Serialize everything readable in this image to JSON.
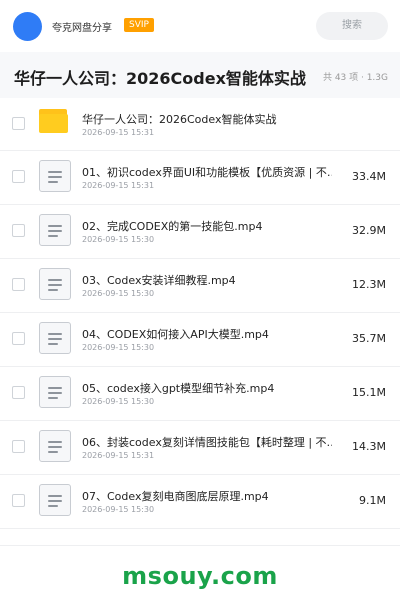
{
  "header": {
    "app_name": "夸克网盘分享",
    "badge": "SVIP",
    "search_label": "搜索"
  },
  "title_bar": {
    "title": "华仔一人公司：2026Codex智能体实战",
    "meta": "共 43 项 · 1.3G"
  },
  "files": [
    {
      "type": "folder",
      "name": "华仔一人公司：2026Codex智能体实战",
      "date": "2026-09-15 15:31",
      "size": ""
    },
    {
      "type": "file",
      "name": "01、初识codex界面UI和功能模板【优质资源 | 不…",
      "date": "2026-09-15 15:31",
      "size": "33.4M"
    },
    {
      "type": "file",
      "name": "02、完成CODEX的第一技能包.mp4",
      "date": "2026-09-15 15:30",
      "size": "32.9M"
    },
    {
      "type": "file",
      "name": "03、Codex安装详细教程.mp4",
      "date": "2026-09-15 15:30",
      "size": "12.3M"
    },
    {
      "type": "file",
      "name": "04、CODEX如何接入API大模型.mp4",
      "date": "2026-09-15 15:30",
      "size": "35.7M"
    },
    {
      "type": "file",
      "name": "05、codex接入gpt模型细节补充.mp4",
      "date": "2026-09-15 15:30",
      "size": "15.1M"
    },
    {
      "type": "file",
      "name": "06、封装codex复刻详情图技能包【耗时整理 | 不…",
      "date": "2026-09-15 15:31",
      "size": "14.3M"
    },
    {
      "type": "file",
      "name": "07、Codex复刻电商图底层原理.mp4",
      "date": "2026-09-15 15:30",
      "size": "9.1M"
    }
  ],
  "watermark": "msouy.com",
  "colors": {
    "accent": "#2f7cf6",
    "badge": "#ffa000",
    "folder": "#ffcc1f",
    "watermark": "#1aa34a"
  }
}
